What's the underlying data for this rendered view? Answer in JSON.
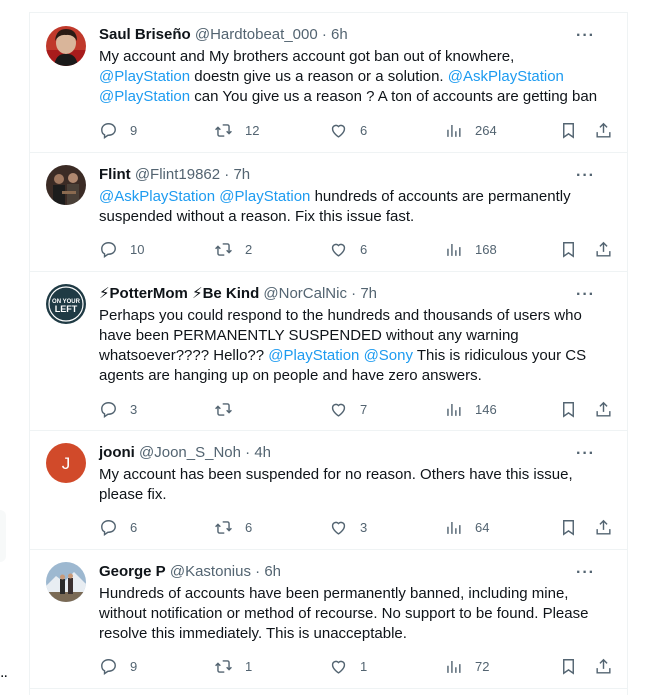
{
  "left_overflow_text": "..",
  "tweets": [
    {
      "name": "Saul Briseño",
      "handle": "@Hardtobeat_000",
      "time": "6h",
      "more": "···",
      "segments": [
        {
          "t": "My account and My brothers account got ban out of knowhere, ",
          "m": false
        },
        {
          "t": "@PlayStation",
          "m": true
        },
        {
          "t": " doestn give us a reason or a solution. ",
          "m": false
        },
        {
          "t": "@AskPlayStation",
          "m": true
        },
        {
          "t": " ",
          "m": false
        },
        {
          "t": "@PlayStation",
          "m": true
        },
        {
          "t": " can You give us a reason ? A ton of accounts are getting ban",
          "m": false
        }
      ],
      "replies": "9",
      "retweets": "12",
      "likes": "6",
      "views": "264",
      "avatar": {
        "bg": "#8b2020",
        "label": "avatar"
      }
    },
    {
      "name": "Flint",
      "handle": "@Flint19862",
      "time": "7h",
      "more": "···",
      "segments": [
        {
          "t": "@AskPlayStation",
          "m": true
        },
        {
          "t": "  ",
          "m": false
        },
        {
          "t": "@PlayStation",
          "m": true
        },
        {
          "t": "  hundreds of accounts are permanently suspended without a reason. Fix this issue fast.",
          "m": false
        }
      ],
      "replies": "10",
      "retweets": "2",
      "likes": "6",
      "views": "168",
      "avatar": {
        "bg": "#2a2a2a",
        "label": "avatar"
      }
    },
    {
      "name": "⚡PotterMom ⚡Be Kind",
      "handle": "@NorCalNic",
      "time": "7h",
      "more": "···",
      "segments": [
        {
          "t": "Perhaps you could respond to the hundreds and thousands of users who have been PERMANENTLY SUSPENDED without any warning whatsoever???? Hello?? ",
          "m": false
        },
        {
          "t": "@PlayStation",
          "m": true
        },
        {
          "t": " ",
          "m": false
        },
        {
          "t": "@Sony",
          "m": true
        },
        {
          "t": " This is ridiculous your CS agents are hanging up on people and have zero answers.",
          "m": false
        }
      ],
      "replies": "3",
      "retweets": "",
      "likes": "7",
      "views": "146",
      "avatar": {
        "bg": "#1f3a44",
        "label": "avatar",
        "badge_lines": [
          "ON YOUR",
          "LEFT"
        ]
      }
    },
    {
      "name": "jooni",
      "handle": "@Joon_S_Noh",
      "time": "4h",
      "more": "···",
      "segments": [
        {
          "t": "My account has been suspended for no reason. Others have this issue, please fix.",
          "m": false
        }
      ],
      "replies": "6",
      "retweets": "6",
      "likes": "3",
      "views": "64",
      "avatar": {
        "bg": "#d14a2a",
        "label": "avatar",
        "letter": "J"
      }
    },
    {
      "name": "George P",
      "handle": "@Kastonius",
      "time": "6h",
      "more": "···",
      "segments": [
        {
          "t": "Hundreds of accounts have been permanently banned, including mine, without notification or method of recourse. No support to be found. Please resolve this immediately. This is unacceptable.",
          "m": false
        }
      ],
      "replies": "9",
      "retweets": "1",
      "likes": "1",
      "views": "72",
      "avatar": {
        "bg": "#8aa7c0",
        "label": "avatar"
      }
    }
  ]
}
